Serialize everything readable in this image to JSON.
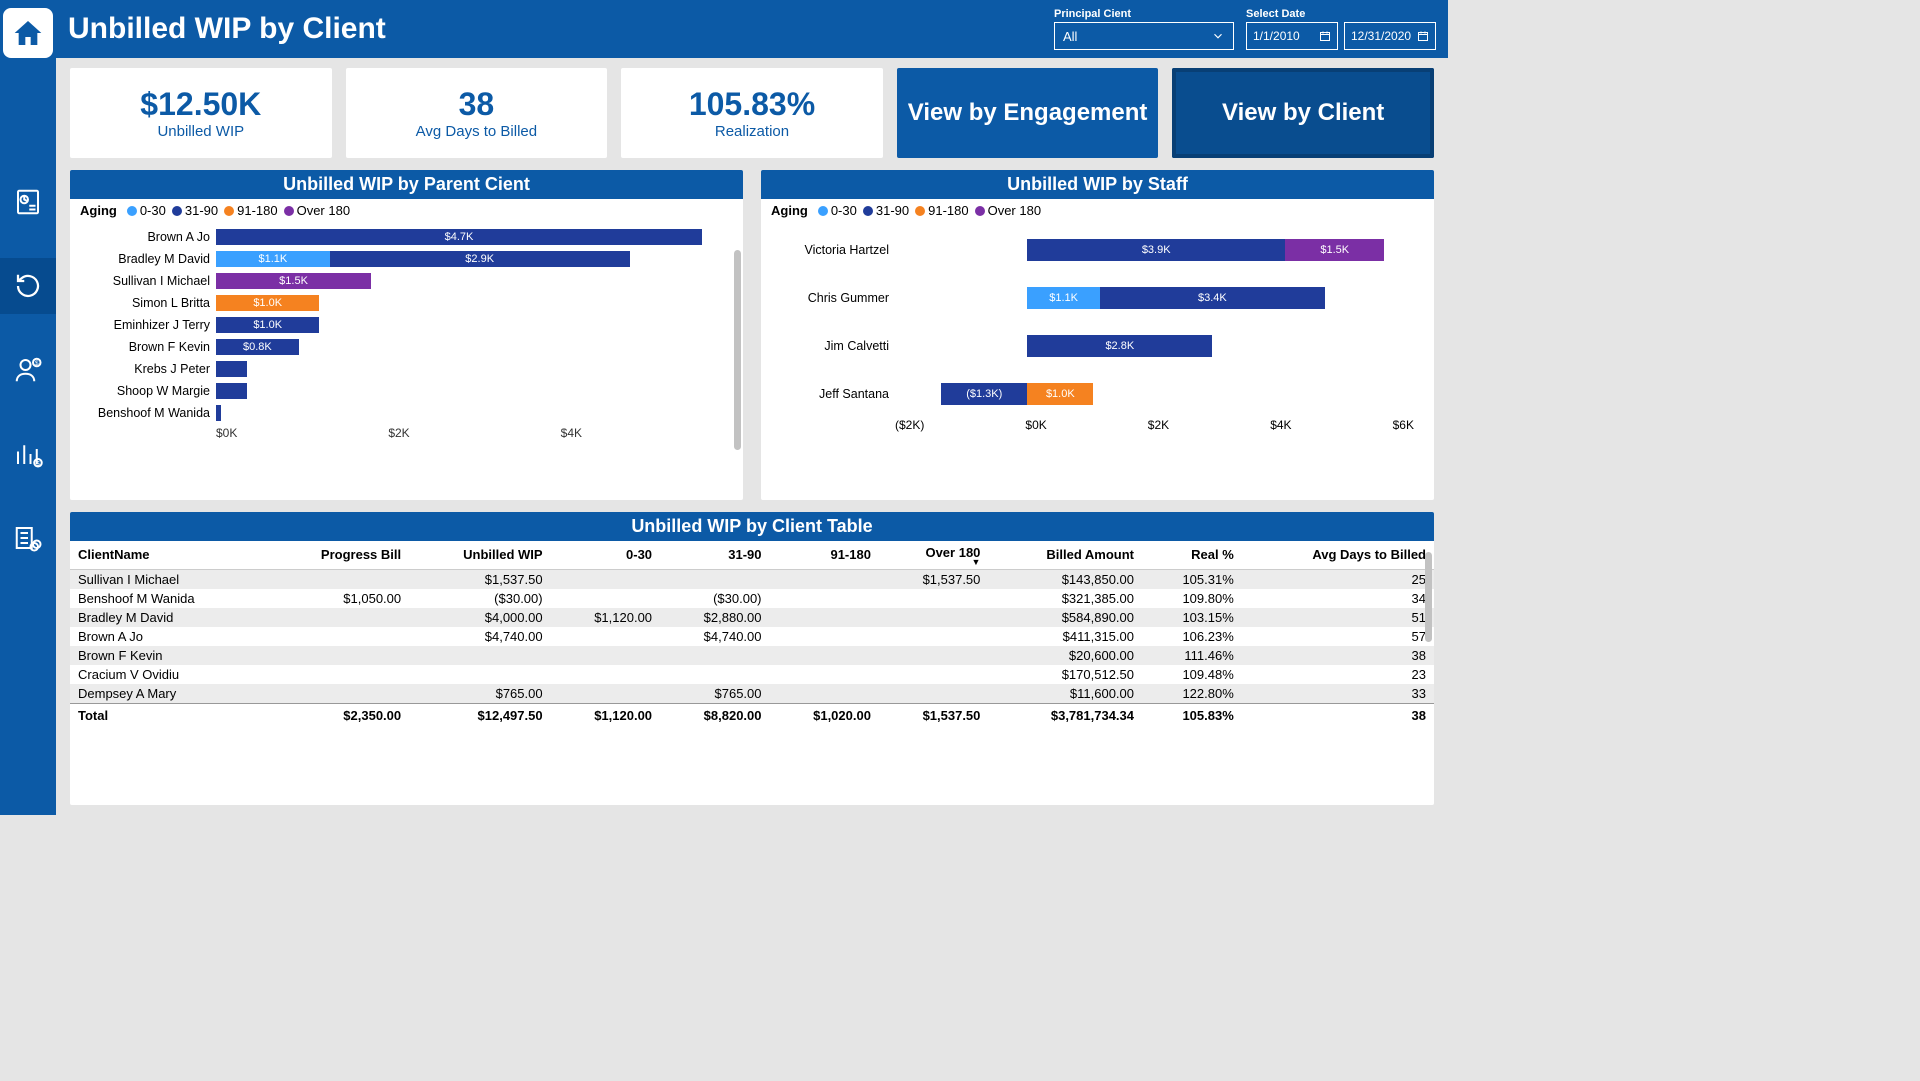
{
  "header": {
    "title": "Unbilled WIP by Client",
    "filter_principal_label": "Principal Cient",
    "filter_principal_value": "All",
    "filter_date_label": "Select Date",
    "date_from": "1/1/2010",
    "date_to": "12/31/2020"
  },
  "kpis": [
    {
      "value": "$12.50K",
      "label": "Unbilled WIP"
    },
    {
      "value": "38",
      "label": "Avg Days to Billed"
    },
    {
      "value": "105.83%",
      "label": "Realization"
    }
  ],
  "view_buttons": {
    "engagement": "View by Engagement",
    "client": "View by Client"
  },
  "legend": {
    "heading": "Aging",
    "buckets": [
      {
        "name": "0-30",
        "color": "#3aa0ff"
      },
      {
        "name": "31-90",
        "color": "#203c9a"
      },
      {
        "name": "91-180",
        "color": "#f58220"
      },
      {
        "name": "Over 180",
        "color": "#7b2fa5"
      }
    ]
  },
  "chart_parent": {
    "title": "Unbilled WIP by Parent Cient",
    "xticks": [
      "$0K",
      "$2K",
      "$4K"
    ],
    "xmax": 5.0
  },
  "chart_staff": {
    "title": "Unbilled WIP by Staff",
    "xticks": [
      "($2K)",
      "$0K",
      "$2K",
      "$4K",
      "$6K"
    ],
    "xmin": -2.0,
    "xmax": 6.0
  },
  "table": {
    "title": "Unbilled WIP by Client Table",
    "columns": [
      "ClientName",
      "Progress Bill",
      "Unbilled WIP",
      "0-30",
      "31-90",
      "91-180",
      "Over 180",
      "Billed Amount",
      "Real %",
      "Avg Days to Billed"
    ],
    "rows": [
      {
        "c": [
          "Sullivan I Michael",
          "",
          "$1,537.50",
          "",
          "",
          "",
          "$1,537.50",
          "$143,850.00",
          "105.31%",
          "25"
        ]
      },
      {
        "c": [
          "Benshoof M Wanida",
          "$1,050.00",
          "($30.00)",
          "",
          "($30.00)",
          "",
          "",
          "$321,385.00",
          "109.80%",
          "34"
        ]
      },
      {
        "c": [
          "Bradley M David",
          "",
          "$4,000.00",
          "$1,120.00",
          "$2,880.00",
          "",
          "",
          "$584,890.00",
          "103.15%",
          "51"
        ]
      },
      {
        "c": [
          "Brown A Jo",
          "",
          "$4,740.00",
          "",
          "$4,740.00",
          "",
          "",
          "$411,315.00",
          "106.23%",
          "57"
        ]
      },
      {
        "c": [
          "Brown F Kevin",
          "",
          "",
          "",
          "",
          "",
          "",
          "$20,600.00",
          "111.46%",
          "38"
        ]
      },
      {
        "c": [
          "Cracium V Ovidiu",
          "",
          "",
          "",
          "",
          "",
          "",
          "$170,512.50",
          "109.48%",
          "23"
        ]
      },
      {
        "c": [
          "Dempsey A Mary",
          "",
          "$765.00",
          "",
          "$765.00",
          "",
          "",
          "$11,600.00",
          "122.80%",
          "33"
        ]
      }
    ],
    "totals": [
      "Total",
      "$2,350.00",
      "$12,497.50",
      "$1,120.00",
      "$8,820.00",
      "$1,020.00",
      "$1,537.50",
      "$3,781,734.34",
      "105.83%",
      "38"
    ]
  },
  "chart_data": [
    {
      "type": "bar",
      "orientation": "horizontal-stacked",
      "title": "Unbilled WIP by Parent Cient",
      "xlabel": "",
      "ylabel": "",
      "x_range": [
        0,
        5
      ],
      "categories": [
        "Brown A Jo",
        "Bradley M David",
        "Sullivan I Michael",
        "Simon L Britta",
        "Eminhizer J Terry",
        "Brown F Kevin",
        "Krebs J Peter",
        "Shoop W Margie",
        "Benshoof M Wanida"
      ],
      "series": [
        {
          "name": "0-30",
          "color": "#3aa0ff",
          "values": [
            0,
            1.1,
            0,
            0,
            0,
            0,
            0,
            0,
            0
          ]
        },
        {
          "name": "31-90",
          "color": "#203c9a",
          "values": [
            4.7,
            2.9,
            0,
            0,
            1.0,
            0.8,
            0.3,
            0.3,
            0.05
          ]
        },
        {
          "name": "91-180",
          "color": "#f58220",
          "values": [
            0,
            0,
            0,
            1.0,
            0,
            0,
            0,
            0,
            0
          ]
        },
        {
          "name": "Over 180",
          "color": "#7b2fa5",
          "values": [
            0,
            0,
            1.5,
            0,
            0,
            0,
            0,
            0,
            0
          ]
        }
      ],
      "data_labels": {
        "Brown A Jo": [
          "$4.7K"
        ],
        "Bradley M David": [
          "$1.1K",
          "$2.9K"
        ],
        "Sullivan I Michael": [
          "$1.5K"
        ],
        "Simon L Britta": [
          "$1.0K"
        ],
        "Eminhizer J Terry": [
          "$1.0K"
        ],
        "Brown F Kevin": [
          "$0.8K"
        ]
      }
    },
    {
      "type": "bar",
      "orientation": "horizontal-stacked",
      "title": "Unbilled WIP by Staff",
      "xlabel": "",
      "ylabel": "",
      "x_range": [
        -2,
        6
      ],
      "categories": [
        "Victoria Hartzel",
        "Chris Gummer",
        "Jim Calvetti",
        "Jeff Santana"
      ],
      "series": [
        {
          "name": "0-30",
          "color": "#3aa0ff",
          "values": [
            0,
            1.1,
            0,
            0
          ]
        },
        {
          "name": "31-90",
          "color": "#203c9a",
          "values": [
            3.9,
            3.4,
            2.8,
            -1.3
          ]
        },
        {
          "name": "91-180",
          "color": "#f58220",
          "values": [
            0,
            0,
            0,
            1.0
          ]
        },
        {
          "name": "Over 180",
          "color": "#7b2fa5",
          "values": [
            1.5,
            0,
            0,
            0
          ]
        }
      ],
      "data_labels": {
        "Victoria Hartzel": [
          "$3.9K",
          "$1.5K"
        ],
        "Chris Gummer": [
          "$1.1K",
          "$3.4K"
        ],
        "Jim Calvetti": [
          "$2.8K"
        ],
        "Jeff Santana": [
          "($1.3K)",
          "$1.0K"
        ]
      }
    }
  ]
}
